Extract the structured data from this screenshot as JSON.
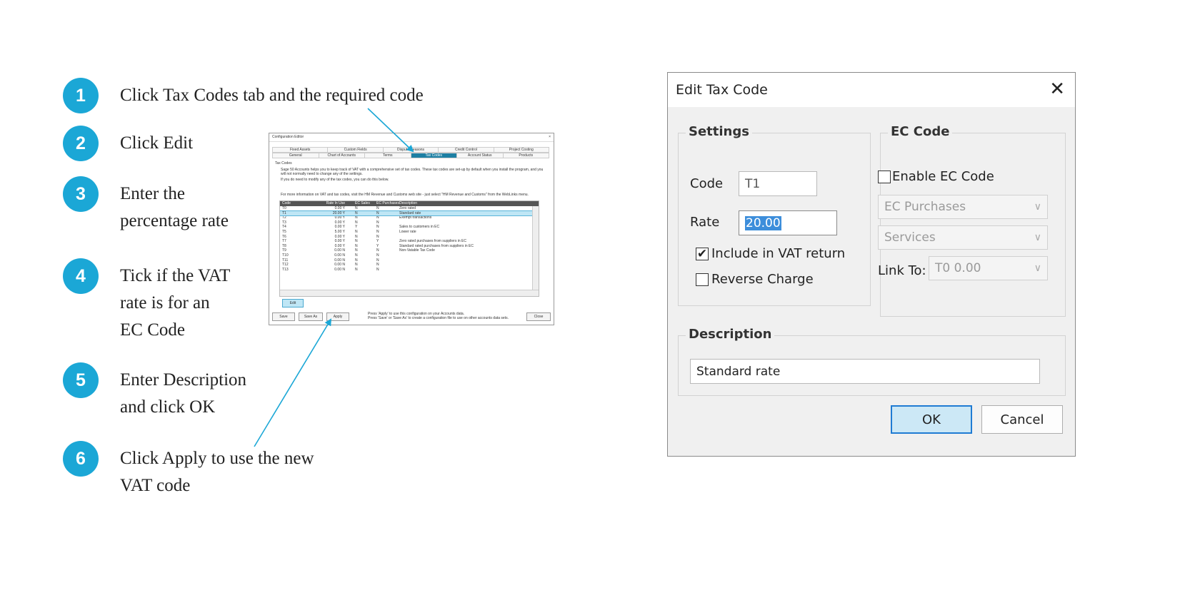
{
  "steps": [
    {
      "num": "1",
      "text": "Click Tax Codes tab and the required code"
    },
    {
      "num": "2",
      "text": "Click Edit"
    },
    {
      "num": "3",
      "text": "Enter the\npercentage rate"
    },
    {
      "num": "4",
      "text": "Tick if the VAT\nrate is for an\nEC Code"
    },
    {
      "num": "5",
      "text": "Enter Description\nand click OK"
    },
    {
      "num": "6",
      "text": "Click Apply to use the new\nVAT code"
    }
  ],
  "config_editor": {
    "title": "Configuration Editor",
    "close": "×",
    "tabs_row1": [
      "Fixed Assets",
      "Custom Fields",
      "Dispute Reasons",
      "Credit Control",
      "Project Costing"
    ],
    "tabs_row2": [
      "General",
      "Chart of Accounts",
      "Terms",
      "Tax Codes",
      "Account Status",
      "Products"
    ],
    "selected_tab": "Tax Codes",
    "section": "Tax Codes",
    "para1": "Sage 50 Accounts helps you to keep track of VAT with a comprehensive set of tax codes. These tax codes are set-up by default when you install the program, and you will not normally need to change any of the settings.",
    "para2": "If you do need to modify any of the tax codes, you can do this below.",
    "para3": "For more information on VAT and tax codes, visit the HM Revenue and Customs web site - just select \"HM Revenue and Customs\" from the WebLinks menu.",
    "columns": [
      "Code",
      "Rate In Use",
      "EC Sales",
      "EC Purchases",
      "Description"
    ],
    "rows": [
      [
        "T0",
        "0.00 Y",
        "N",
        "N",
        "Zero rated"
      ],
      [
        "T1",
        "20.00 Y",
        "N",
        "N",
        "Standard rate"
      ],
      [
        "T2",
        "0.00 Y",
        "N",
        "N",
        "Exempt transactions"
      ],
      [
        "T3",
        "0.00 Y",
        "N",
        "N",
        ""
      ],
      [
        "T4",
        "0.00 Y",
        "Y",
        "N",
        "Sales to customers in EC"
      ],
      [
        "T5",
        "5.00 Y",
        "N",
        "N",
        "Lower rate"
      ],
      [
        "T6",
        "0.00 Y",
        "N",
        "N",
        ""
      ],
      [
        "T7",
        "0.00 Y",
        "N",
        "Y",
        "Zero rated purchases from suppliers in EC"
      ],
      [
        "T8",
        "0.00 Y",
        "N",
        "Y",
        "Standard rated purchases from suppliers in EC"
      ],
      [
        "T9",
        "0.00 N",
        "N",
        "N",
        "Non-Vatable Tax Code"
      ],
      [
        "T10",
        "0.00 N",
        "N",
        "N",
        ""
      ],
      [
        "T11",
        "0.00 N",
        "N",
        "N",
        ""
      ],
      [
        "T12",
        "0.00 N",
        "N",
        "N",
        ""
      ],
      [
        "T13",
        "0.00 N",
        "N",
        "N",
        ""
      ]
    ],
    "edit": "Edit",
    "save": "Save",
    "save_as": "Save As",
    "apply": "Apply",
    "close_btn": "Close",
    "footer1": "Press 'Apply' to use this configuration on your Accounts data.",
    "footer2": "Press 'Save' or 'Save As' to create a configuration file to use on other accounts data sets."
  },
  "dialog": {
    "title": "Edit Tax Code",
    "close": "✕",
    "settings_legend": "Settings",
    "code_label": "Code",
    "code_value": "T1",
    "rate_label": "Rate",
    "rate_value": "20.00",
    "include_vat_label": "Include in VAT return",
    "include_vat_checked": true,
    "reverse_charge_label": "Reverse Charge",
    "reverse_charge_checked": false,
    "ec_legend": "EC Code",
    "enable_ec_label": "Enable EC Code",
    "enable_ec_checked": false,
    "ec_type": "EC Purchases",
    "ec_category": "Services",
    "link_to_label": "Link To:",
    "link_to_value": "T0  0.00",
    "description_legend": "Description",
    "description_value": "Standard rate",
    "ok": "OK",
    "cancel": "Cancel",
    "check_glyph": "✔",
    "chevron_glyph": "∨"
  },
  "colors": {
    "accent": "#1ba7d6",
    "tab_selected": "#1d7fa3",
    "ok_border": "#1f7bd3"
  }
}
